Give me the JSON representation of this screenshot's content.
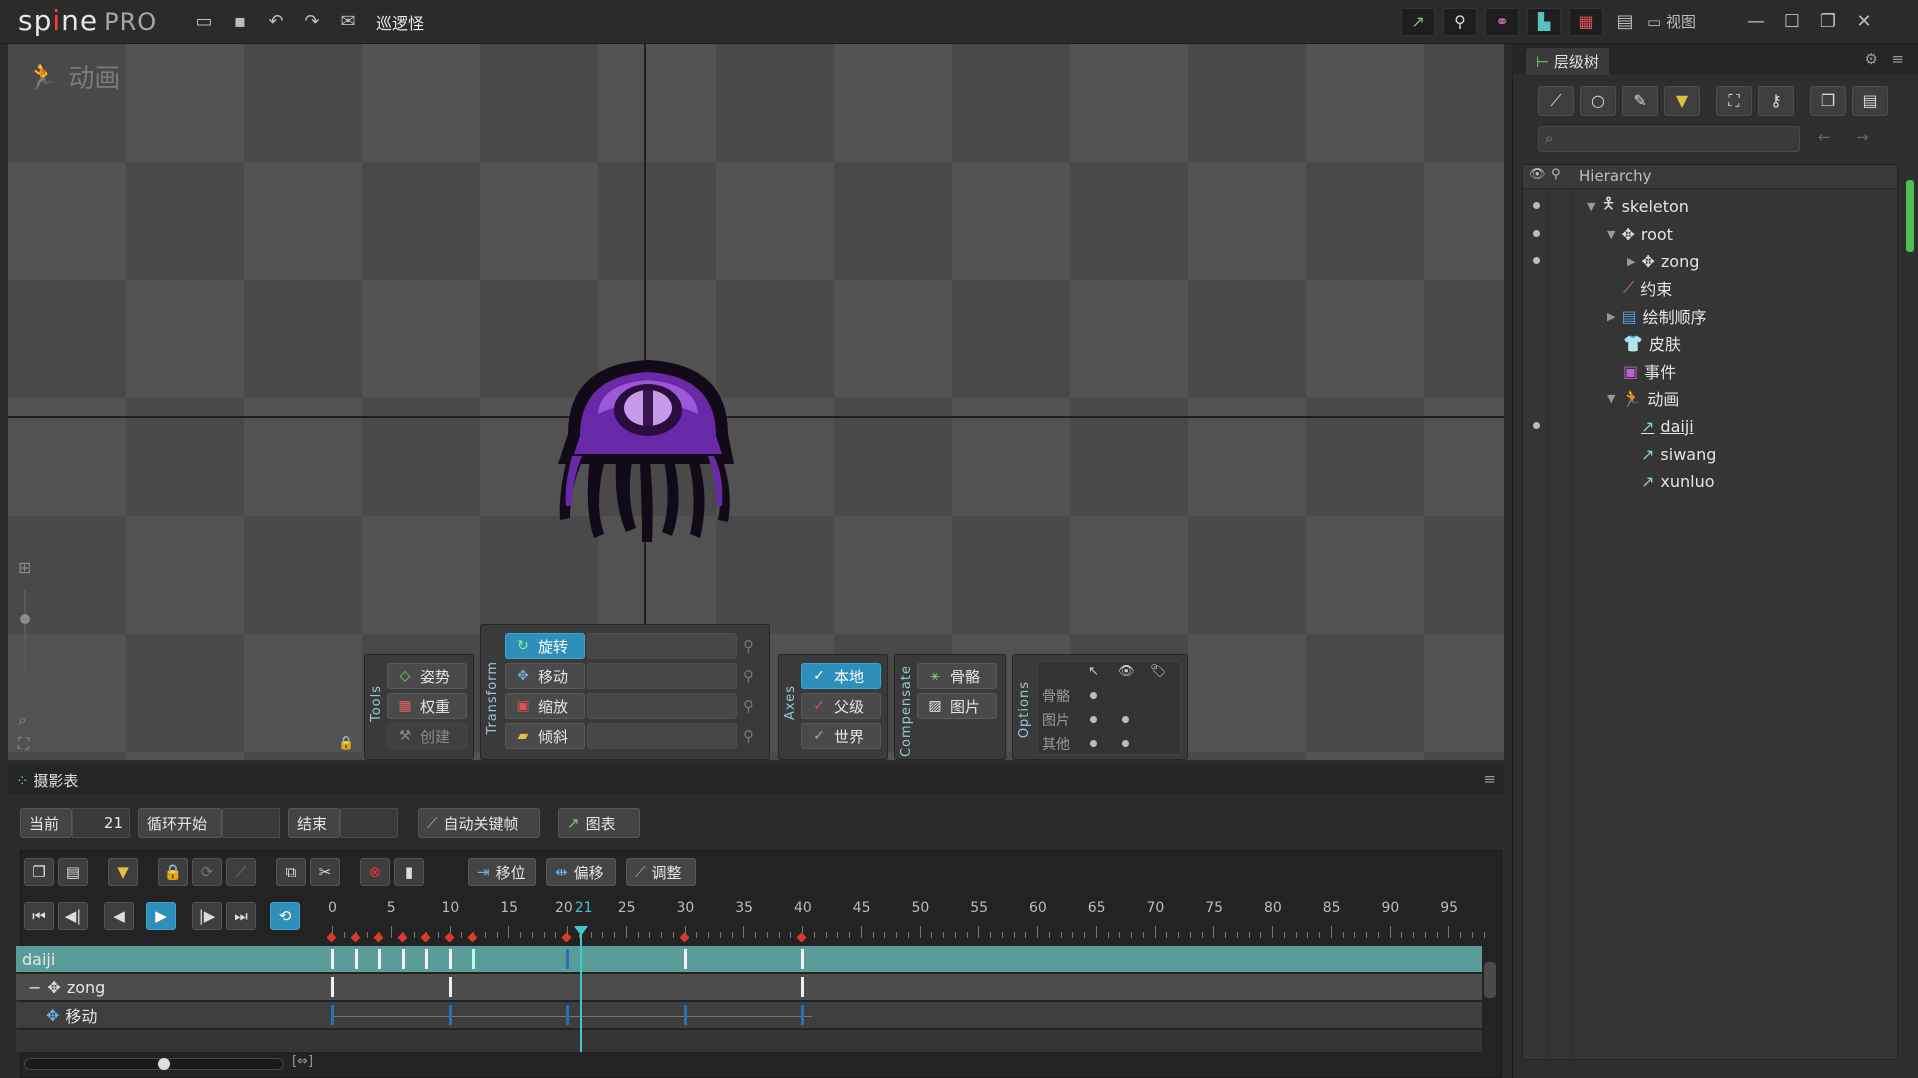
{
  "app": {
    "logo_a": "sp",
    "logo_dot": "i",
    "logo_b": "ne",
    "edition": "PRO",
    "project": "巡逻怪"
  },
  "menu": {
    "view": "视图"
  },
  "viewport": {
    "title": "动画"
  },
  "tools": {
    "label": "Tools",
    "pose": "姿势",
    "weights": "权重",
    "create": "创建"
  },
  "transform": {
    "label": "Transform",
    "rotate": "旋转",
    "translate": "移动",
    "scale": "缩放",
    "shear": "倾斜"
  },
  "axes": {
    "label": "Axes",
    "local": "本地",
    "parent": "父级",
    "world": "世界"
  },
  "compensate": {
    "label": "Compensate",
    "bones": "骨骼",
    "images": "图片"
  },
  "options": {
    "label": "Options",
    "bones": "骨骼",
    "images": "图片",
    "others": "其他"
  },
  "hierarchy": {
    "tab": "层级树",
    "header": "Hierarchy",
    "search_placeholder": "",
    "items": [
      {
        "label": "skeleton",
        "icon": "skeleton-icon"
      },
      {
        "label": "root",
        "icon": "bone-icon"
      },
      {
        "label": "zong",
        "icon": "bone-icon"
      },
      {
        "label": "约束",
        "icon": "constraint-icon"
      },
      {
        "label": "绘制顺序",
        "icon": "draw-order-icon"
      },
      {
        "label": "皮肤",
        "icon": "skin-icon"
      },
      {
        "label": "事件",
        "icon": "event-icon"
      },
      {
        "label": "动画",
        "icon": "animation-icon"
      },
      {
        "label": "daiji",
        "icon": "animation-item-icon"
      },
      {
        "label": "siwang",
        "icon": "animation-item-icon"
      },
      {
        "label": "xunluo",
        "icon": "animation-item-icon"
      }
    ]
  },
  "dopesheet": {
    "tab": "摄影表",
    "current_label": "当前",
    "current_value": "21",
    "loop_start": "循环开始",
    "loop_start_value": "",
    "end": "结束",
    "end_value": "",
    "auto_key": "自动关键帧",
    "graph": "图表",
    "offset_move": "移位",
    "offset": "偏移",
    "adjust": "调整",
    "ticks": [
      "0",
      "5",
      "10",
      "15",
      "20",
      "21",
      "25",
      "30",
      "35",
      "40",
      "45",
      "50",
      "55",
      "60",
      "65",
      "70",
      "75",
      "80",
      "85",
      "90",
      "95"
    ],
    "rows": [
      {
        "label": "daiji"
      },
      {
        "label": "zong"
      },
      {
        "label": "移动"
      }
    ]
  },
  "colors": {
    "accent": "#2e8fbb",
    "teal": "#5a9c97",
    "key": "#e03b2a"
  }
}
